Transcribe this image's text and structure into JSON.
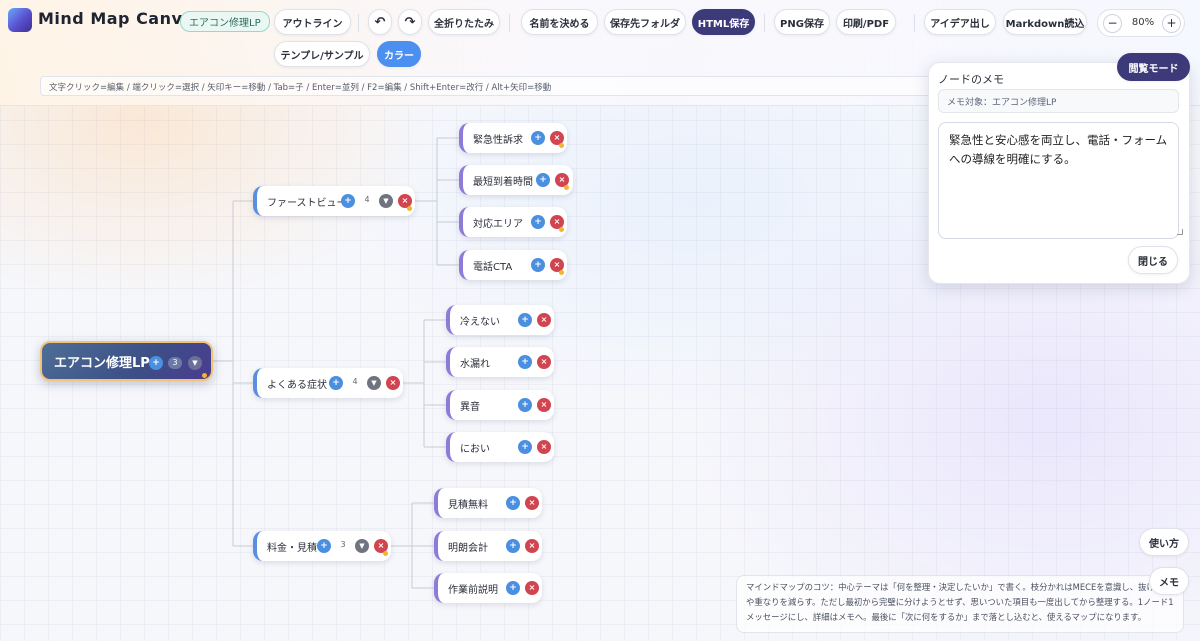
{
  "app": {
    "title": "Mind Map Canvas",
    "document_name": "エアコン修理LP"
  },
  "toolbar": {
    "outline": "アウトライン",
    "undo_icon": "↶",
    "redo_icon": "↷",
    "collapse_all": "全折りたたみ",
    "name_it": "名前を決める",
    "save_folder": "保存先フォルダ",
    "html_save": "HTML保存",
    "png_save": "PNG保存",
    "print_pdf": "印刷/PDF",
    "idea": "アイデア出し",
    "markdown_import": "Markdown読込",
    "zoom_out": "−",
    "zoom_value": "80%",
    "zoom_in": "+",
    "template": "テンプレ/サンプル",
    "color": "カラー"
  },
  "hint": "文字クリック=編集 / 端クリック=選択 / 矢印キー=移動 / Tab=子 / Enter=並列 / F2=編集 / Shift+Enter=改行 / Alt+矢印=移動",
  "mindmap": {
    "root": {
      "label": "エアコン修理LP",
      "count": "3"
    },
    "branches": [
      {
        "label": "ファーストビュー",
        "count": "4",
        "children": [
          "緊急性訴求",
          "最短到着時間",
          "対応エリア",
          "電話CTA"
        ]
      },
      {
        "label": "よくある症状",
        "count": "4",
        "children": [
          "冷えない",
          "水漏れ",
          "異音",
          "におい"
        ]
      },
      {
        "label": "料金・見積",
        "count": "3",
        "children": [
          "見積無料",
          "明朗会計",
          "作業前説明"
        ]
      }
    ]
  },
  "memo": {
    "view_mode": "閲覧モード",
    "title": "ノードのメモ",
    "target": "メモ対象：エアコン修理LP",
    "text": "緊急性と安心感を両立し、電話・フォームへの導線を明確にする。",
    "close": "閉じる"
  },
  "help_button": "使い方",
  "memo_button": "メモ",
  "tip": "マインドマップのコツ：中心テーマは「何を整理・決定したいか」で書く。枝分かれはMECEを意識し、抜け漏れや重なりを減らす。ただし最初から完璧に分けようとせず、思いついた項目も一度出してから整理する。1ノード1メッセージにし、詳細はメモへ。最後に「次に何をするか」まで落とし込むと、使えるマップになります。",
  "icons": {
    "add": "+",
    "delete": "×",
    "fold": "▼"
  },
  "colors": {
    "accent_blue": "#4b8fe0",
    "delete_red": "#d0454f",
    "html_save_bg": "#3d3a7a",
    "branch_border": "#5a8fe0",
    "leaf_border": "#8d7ad9"
  }
}
